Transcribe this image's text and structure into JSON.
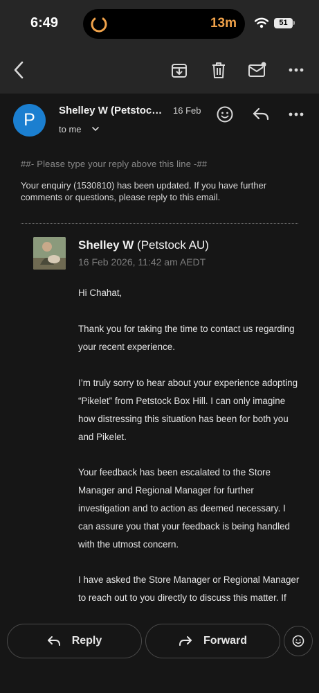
{
  "status_bar": {
    "time": "6:49",
    "timer": "13m",
    "battery": "51"
  },
  "toolbar": {
    "icons": [
      "back-arrow-icon",
      "archive-icon",
      "trash-icon",
      "mark-unread-icon",
      "more-icon"
    ]
  },
  "message": {
    "avatar_letter": "P",
    "sender": "Shelley W (Petstock AU)",
    "date": "16 Feb",
    "to": "to me"
  },
  "body": {
    "reply_marker": "##- Please type your reply above this line -##",
    "updated_notice": "Your enquiry (1530810) has been updated. If you have further comments or questions, please reply to this email.",
    "quote": {
      "name": "Shelley W",
      "org": "(Petstock AU)",
      "date": "16 Feb 2026, 11:42 am AEDT"
    },
    "paragraphs": [
      "Hi Chahat,",
      "Thank you for taking the time to contact us regarding your recent experience.",
      "I’m truly sorry to hear about your experience adopting “Pikelet” from Petstock Box Hill. I can only imagine how distressing this situation has been for both you and Pikelet.",
      "Your feedback has been escalated to the Store Manager and Regional Manager for further investigation and to action as deemed necessary. I can assure you that your feedback is being handled with the utmost concern.",
      "I have asked the Store Manager or Regional Manager to reach out to you directly to discuss this matter. If you do not receive a response"
    ]
  },
  "actions": {
    "reply": "Reply",
    "forward": "Forward"
  },
  "colors": {
    "background": "#161616",
    "toolbar": "#262626",
    "avatar": "#1b7fd0",
    "timer": "#f0a24a"
  }
}
